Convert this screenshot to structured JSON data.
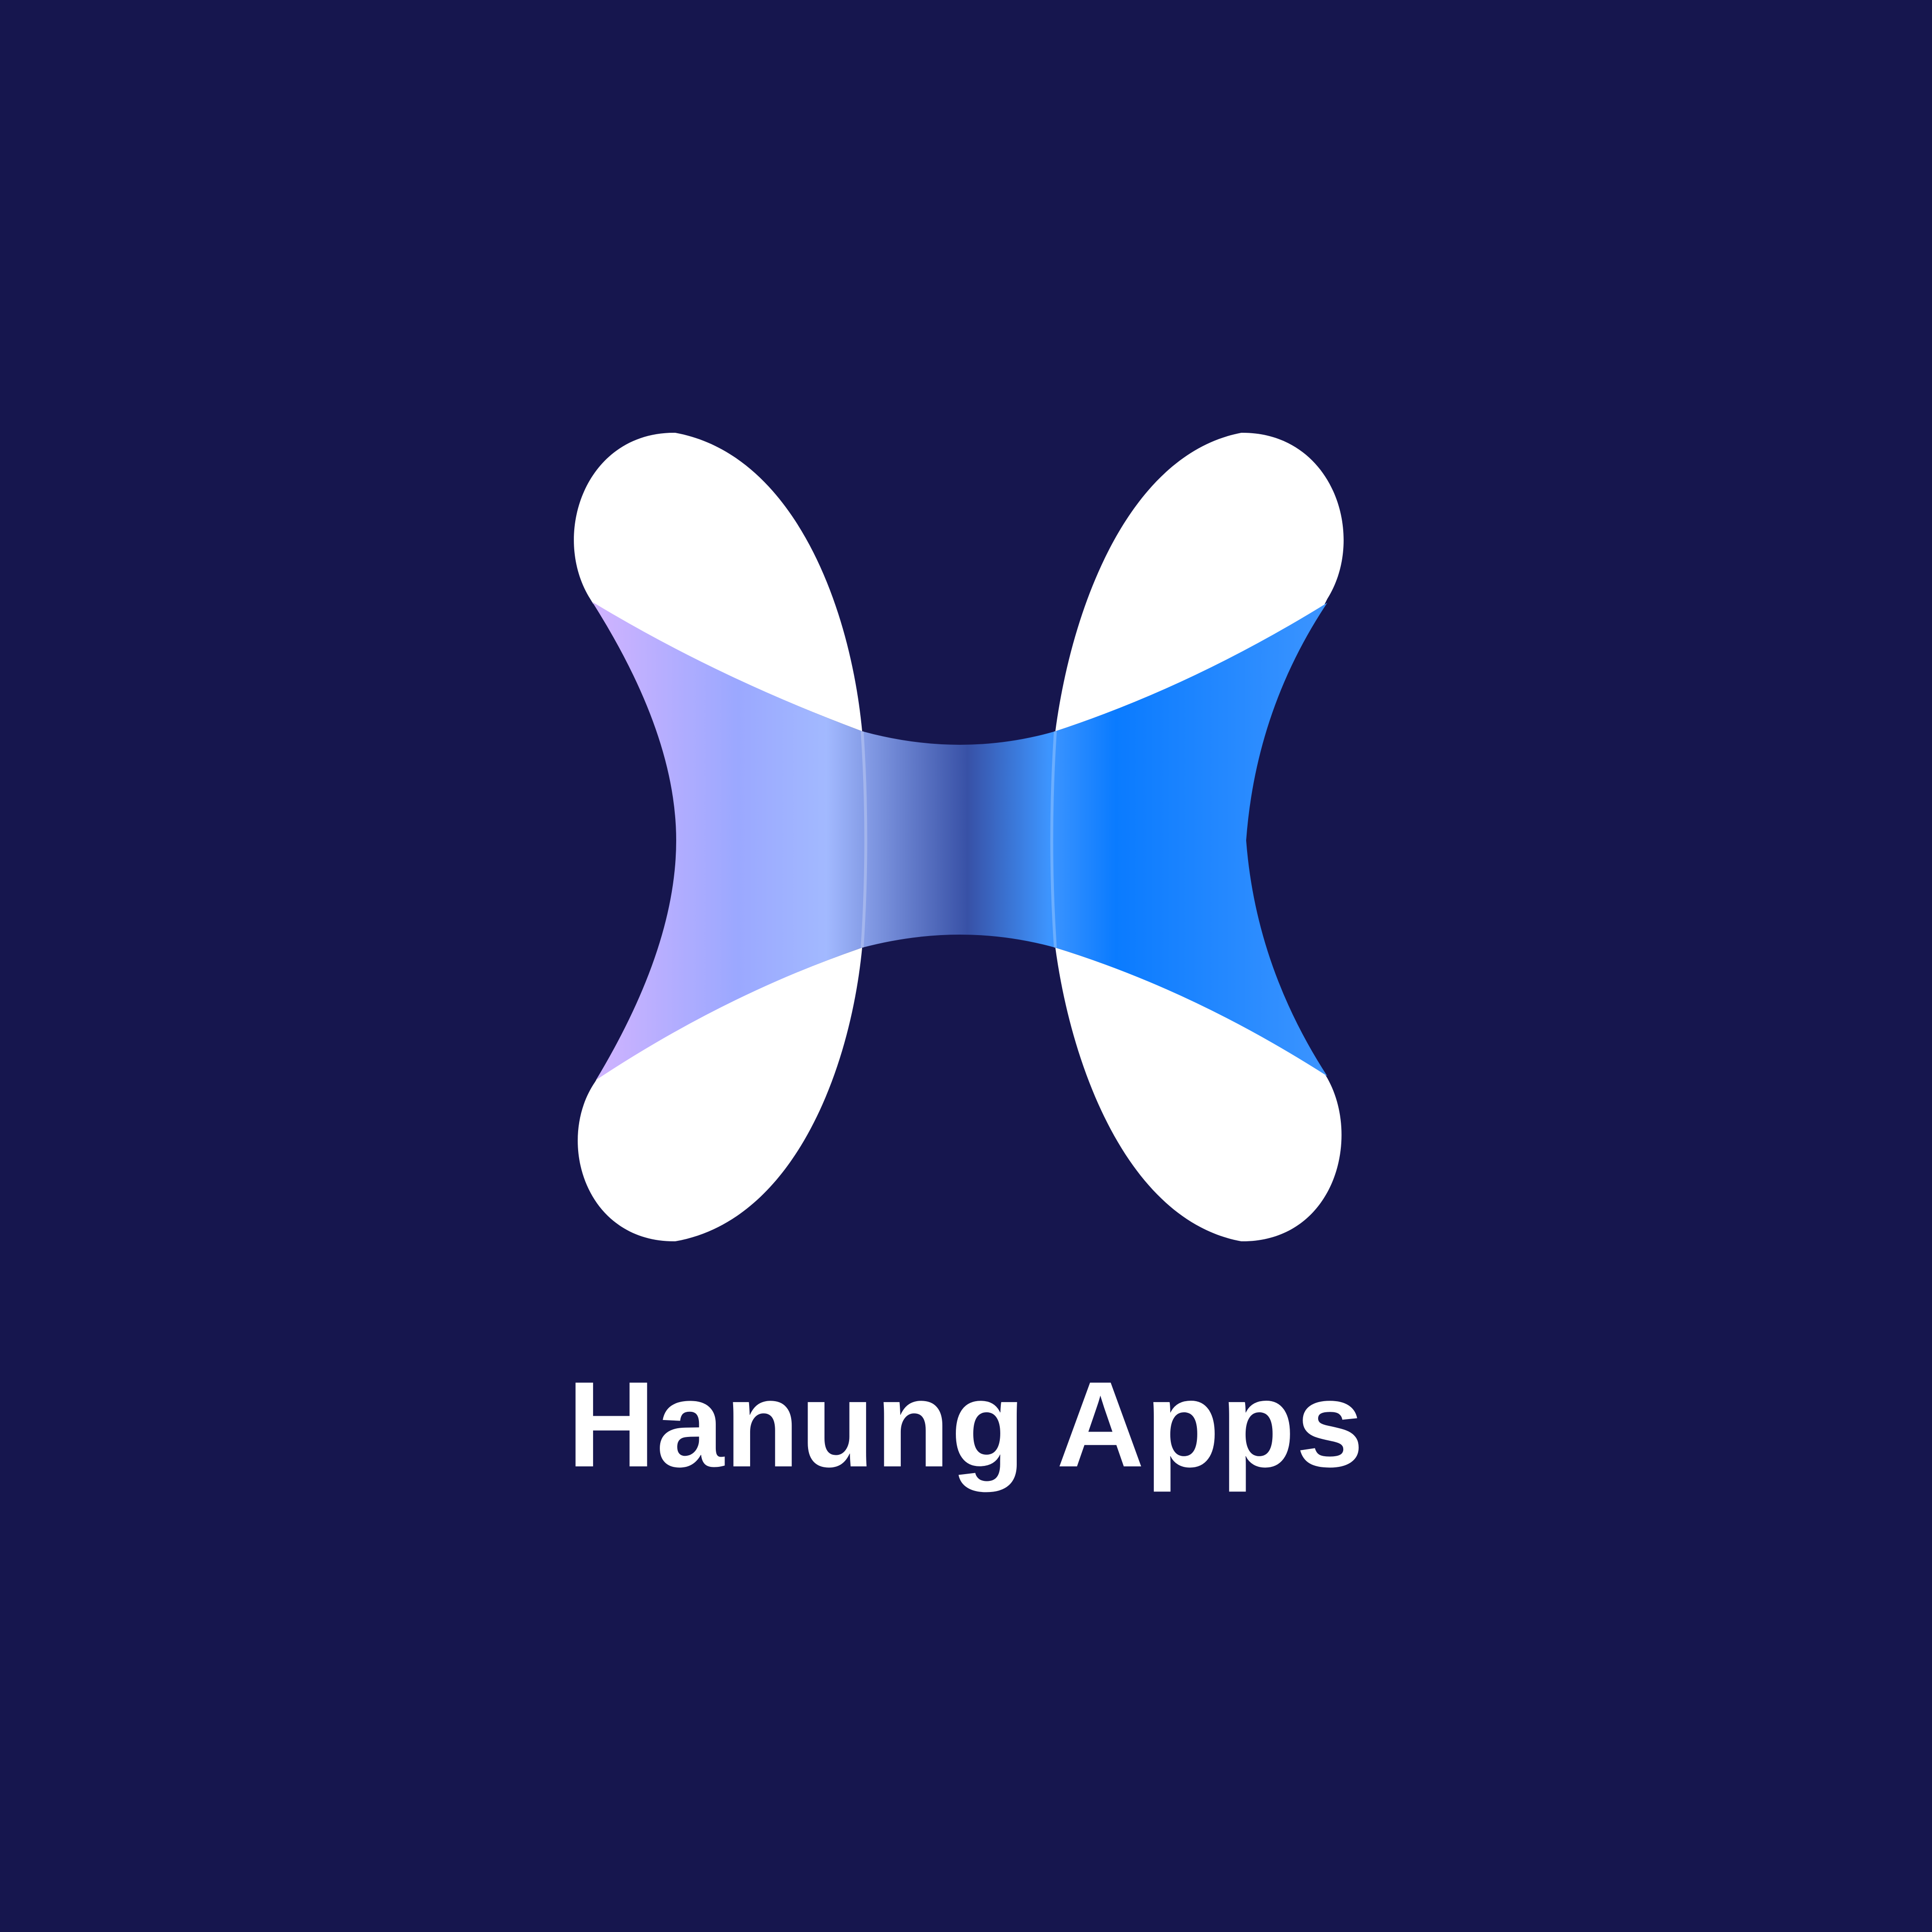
{
  "brand": {
    "name": "Hanung Apps"
  },
  "logo": {
    "icon": "stylized-h-logo-icon"
  },
  "colors": {
    "background": "#16164E",
    "mark_white": "#FFFFFF",
    "text": "#FFFFFF",
    "gradient_lavender": "#D2B4FF",
    "gradient_periwinkle": "#9BA8FF",
    "gradient_pale_blue": "#A2B9FF",
    "gradient_mid_navy": "#3851A6",
    "gradient_blue": "#0A7BFF",
    "gradient_sky": "#3D95FF"
  }
}
